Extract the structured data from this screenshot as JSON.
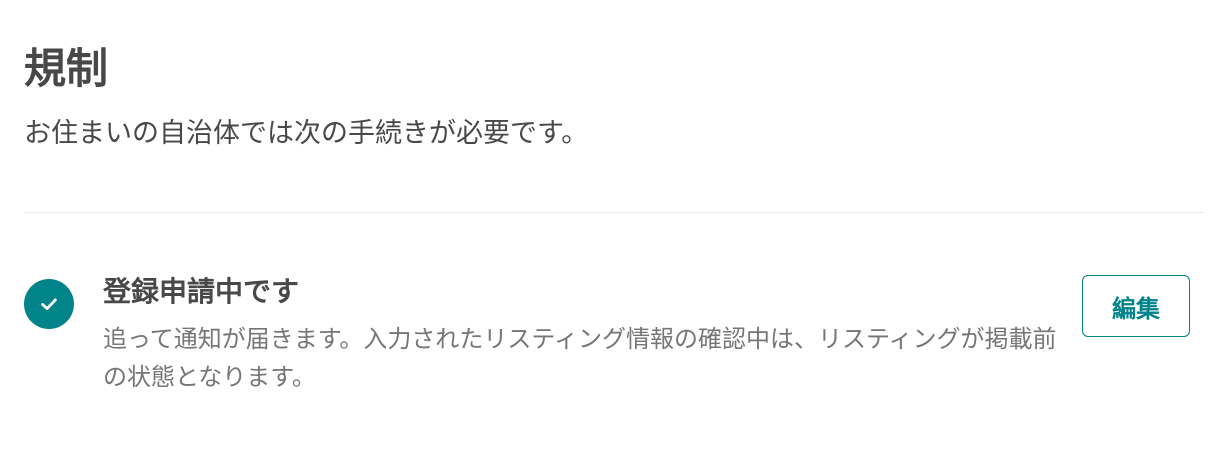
{
  "regulations": {
    "title": "規制",
    "subtitle": "お住まいの自治体では次の手続きが必要です。",
    "status": {
      "icon": "check-circle-icon",
      "accent_color": "#008489",
      "title": "登録申請中です",
      "description": "追って通知が届きます。入力されたリスティング情報の確認中は、リスティングが掲載前の状態となります。",
      "edit_label": "編集"
    }
  }
}
